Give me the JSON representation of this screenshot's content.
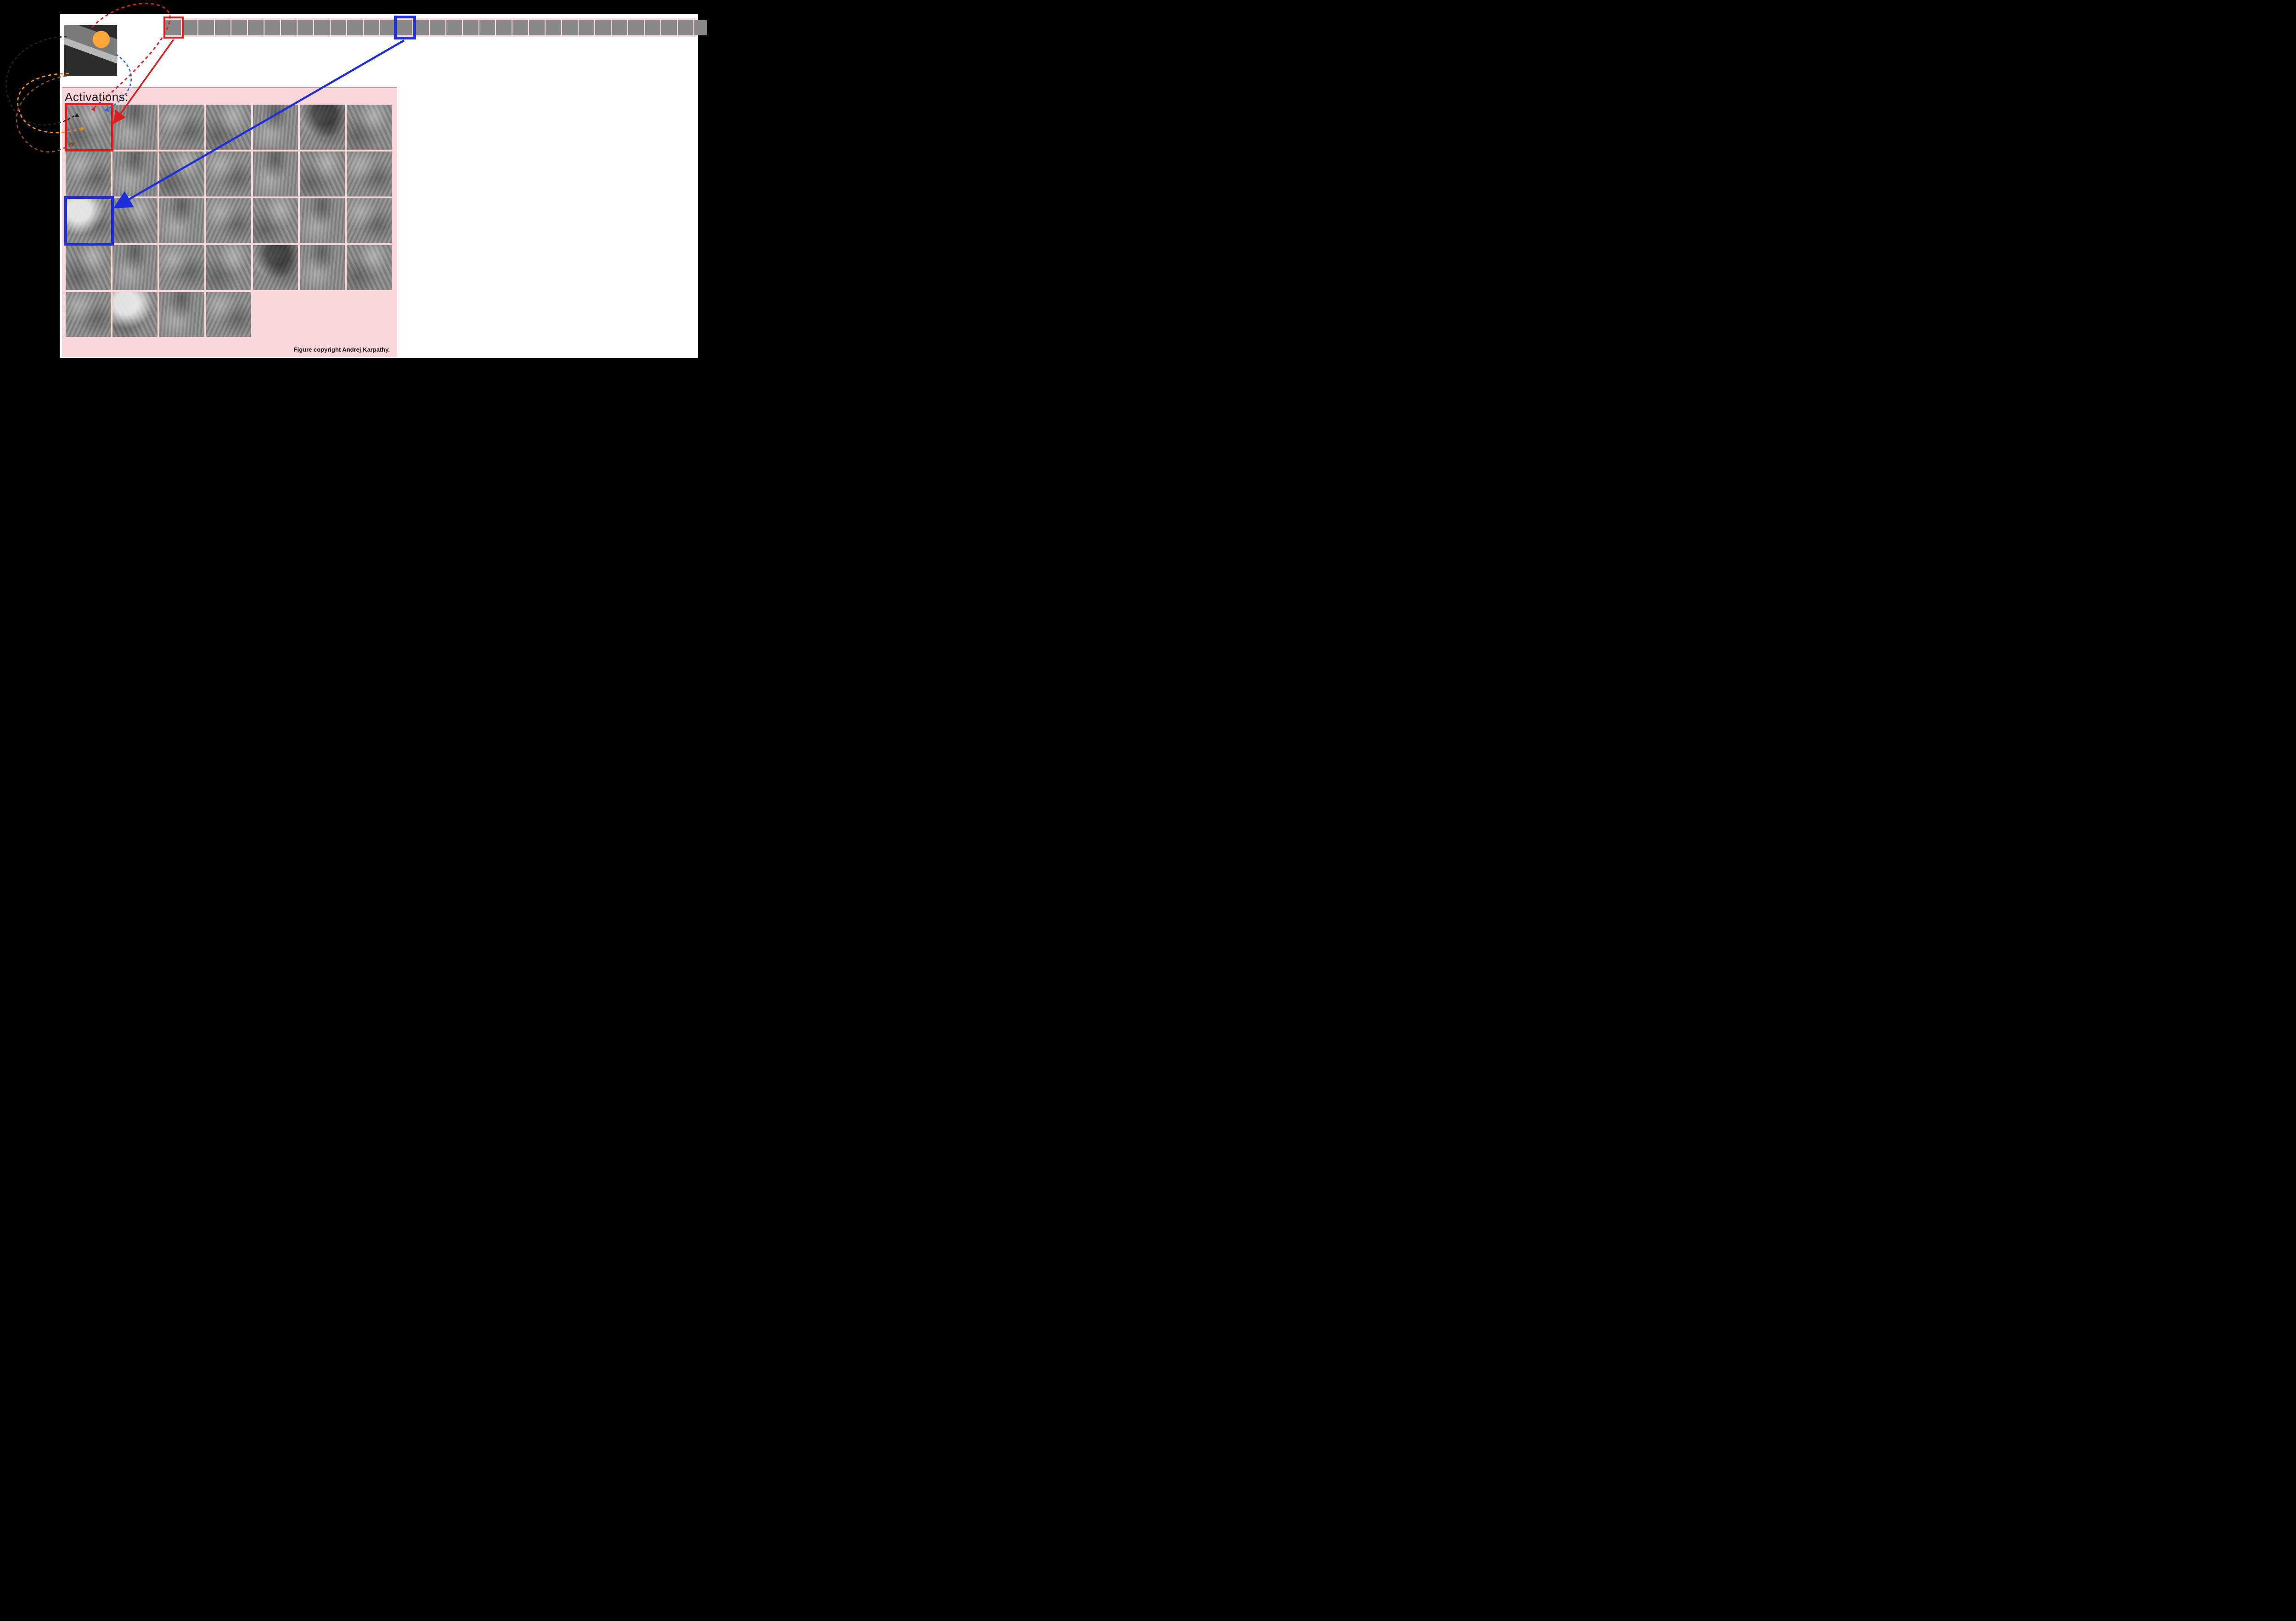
{
  "labels": {
    "activations_title": "Activations:",
    "caption": "Figure copyright Andrej Karpathy."
  },
  "filter_strip": {
    "count": 33,
    "highlight_red_index": 0,
    "highlight_blue_index": 14,
    "icon_names": [
      "filter-0",
      "filter-1",
      "filter-2",
      "filter-3",
      "filter-4",
      "filter-5",
      "filter-6",
      "filter-7",
      "filter-8",
      "filter-9",
      "filter-10",
      "filter-11",
      "filter-12",
      "filter-13",
      "filter-14",
      "filter-15",
      "filter-16",
      "filter-17",
      "filter-18",
      "filter-19",
      "filter-20",
      "filter-21",
      "filter-22",
      "filter-23",
      "filter-24",
      "filter-25",
      "filter-26",
      "filter-27",
      "filter-28",
      "filter-29",
      "filter-30",
      "filter-31",
      "filter-32"
    ]
  },
  "activations_grid": {
    "columns": 7,
    "rows_full": 4,
    "last_row_count": 4,
    "total": 32,
    "highlight_red_index": 0,
    "highlight_blue_index": 14
  },
  "arrows": {
    "solid_red": {
      "from": "filter-0",
      "to": "activation-0"
    },
    "solid_blue": {
      "from": "filter-14",
      "to": "activation-14"
    },
    "dashed_paths": [
      {
        "color": "#d81e1e",
        "desc": "input-image → activation-0 top"
      },
      {
        "color": "#2a66d8",
        "desc": "input-image → activation-0 right"
      },
      {
        "color": "#222222",
        "desc": "input-image → activation-0 upper-left"
      },
      {
        "color": "#f08a1a",
        "desc": "input-image → activation-0 mid-left"
      },
      {
        "color": "#8a4a2e",
        "desc": "input-image → activation-0 lower-left"
      }
    ]
  },
  "colors": {
    "highlight_red": "#d81e1e",
    "highlight_blue": "#1d2fd9",
    "panel_pink": "#f9d6da",
    "strip_pink": "#fcdadf"
  }
}
